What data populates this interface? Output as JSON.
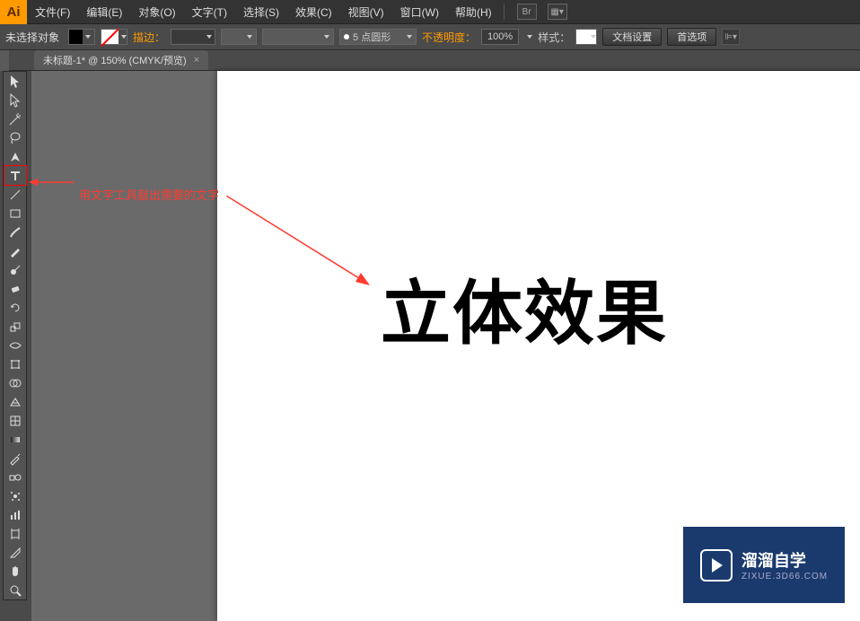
{
  "app": {
    "icon": "Ai"
  },
  "menu": {
    "items": [
      "文件(F)",
      "编辑(E)",
      "对象(O)",
      "文字(T)",
      "选择(S)",
      "效果(C)",
      "视图(V)",
      "窗口(W)",
      "帮助(H)"
    ]
  },
  "controlbar": {
    "selection": "未选择对象",
    "stroke_label": "描边：",
    "stroke_width": "",
    "brush_label": "5 点圆形",
    "opacity_label": "不透明度：",
    "opacity_value": "100%",
    "style_label": "样式：",
    "docsetup_btn": "文档设置",
    "prefs_btn": "首选项"
  },
  "tab": {
    "title": "未标题-1* @ 150% (CMYK/预览)"
  },
  "tools": [
    {
      "name": "selection-tool"
    },
    {
      "name": "direct-select-tool"
    },
    {
      "name": "wand-tool"
    },
    {
      "name": "lasso-tool"
    },
    {
      "name": "pen-tool"
    },
    {
      "name": "type-tool",
      "selected": true
    },
    {
      "name": "line-tool"
    },
    {
      "name": "rect-tool"
    },
    {
      "name": "brush-tool"
    },
    {
      "name": "pencil-tool"
    },
    {
      "name": "blob-tool"
    },
    {
      "name": "eraser-tool"
    },
    {
      "name": "rotate-tool"
    },
    {
      "name": "scale-tool"
    },
    {
      "name": "width-tool"
    },
    {
      "name": "free-transform-tool"
    },
    {
      "name": "shapebuilder-tool"
    },
    {
      "name": "perspective-tool"
    },
    {
      "name": "mesh-tool"
    },
    {
      "name": "gradient-tool"
    },
    {
      "name": "eyedropper-tool"
    },
    {
      "name": "blend-tool"
    },
    {
      "name": "symbol-tool"
    },
    {
      "name": "graph-tool"
    },
    {
      "name": "artboard-tool"
    },
    {
      "name": "slice-tool"
    },
    {
      "name": "hand-tool"
    },
    {
      "name": "zoom-tool"
    }
  ],
  "annotation": {
    "text": "用文字工具敲出需要的文字"
  },
  "canvas": {
    "text": "立体效果"
  },
  "watermark": {
    "main": "溜溜自学",
    "sub": "ZIXUE.3D66.COM"
  }
}
